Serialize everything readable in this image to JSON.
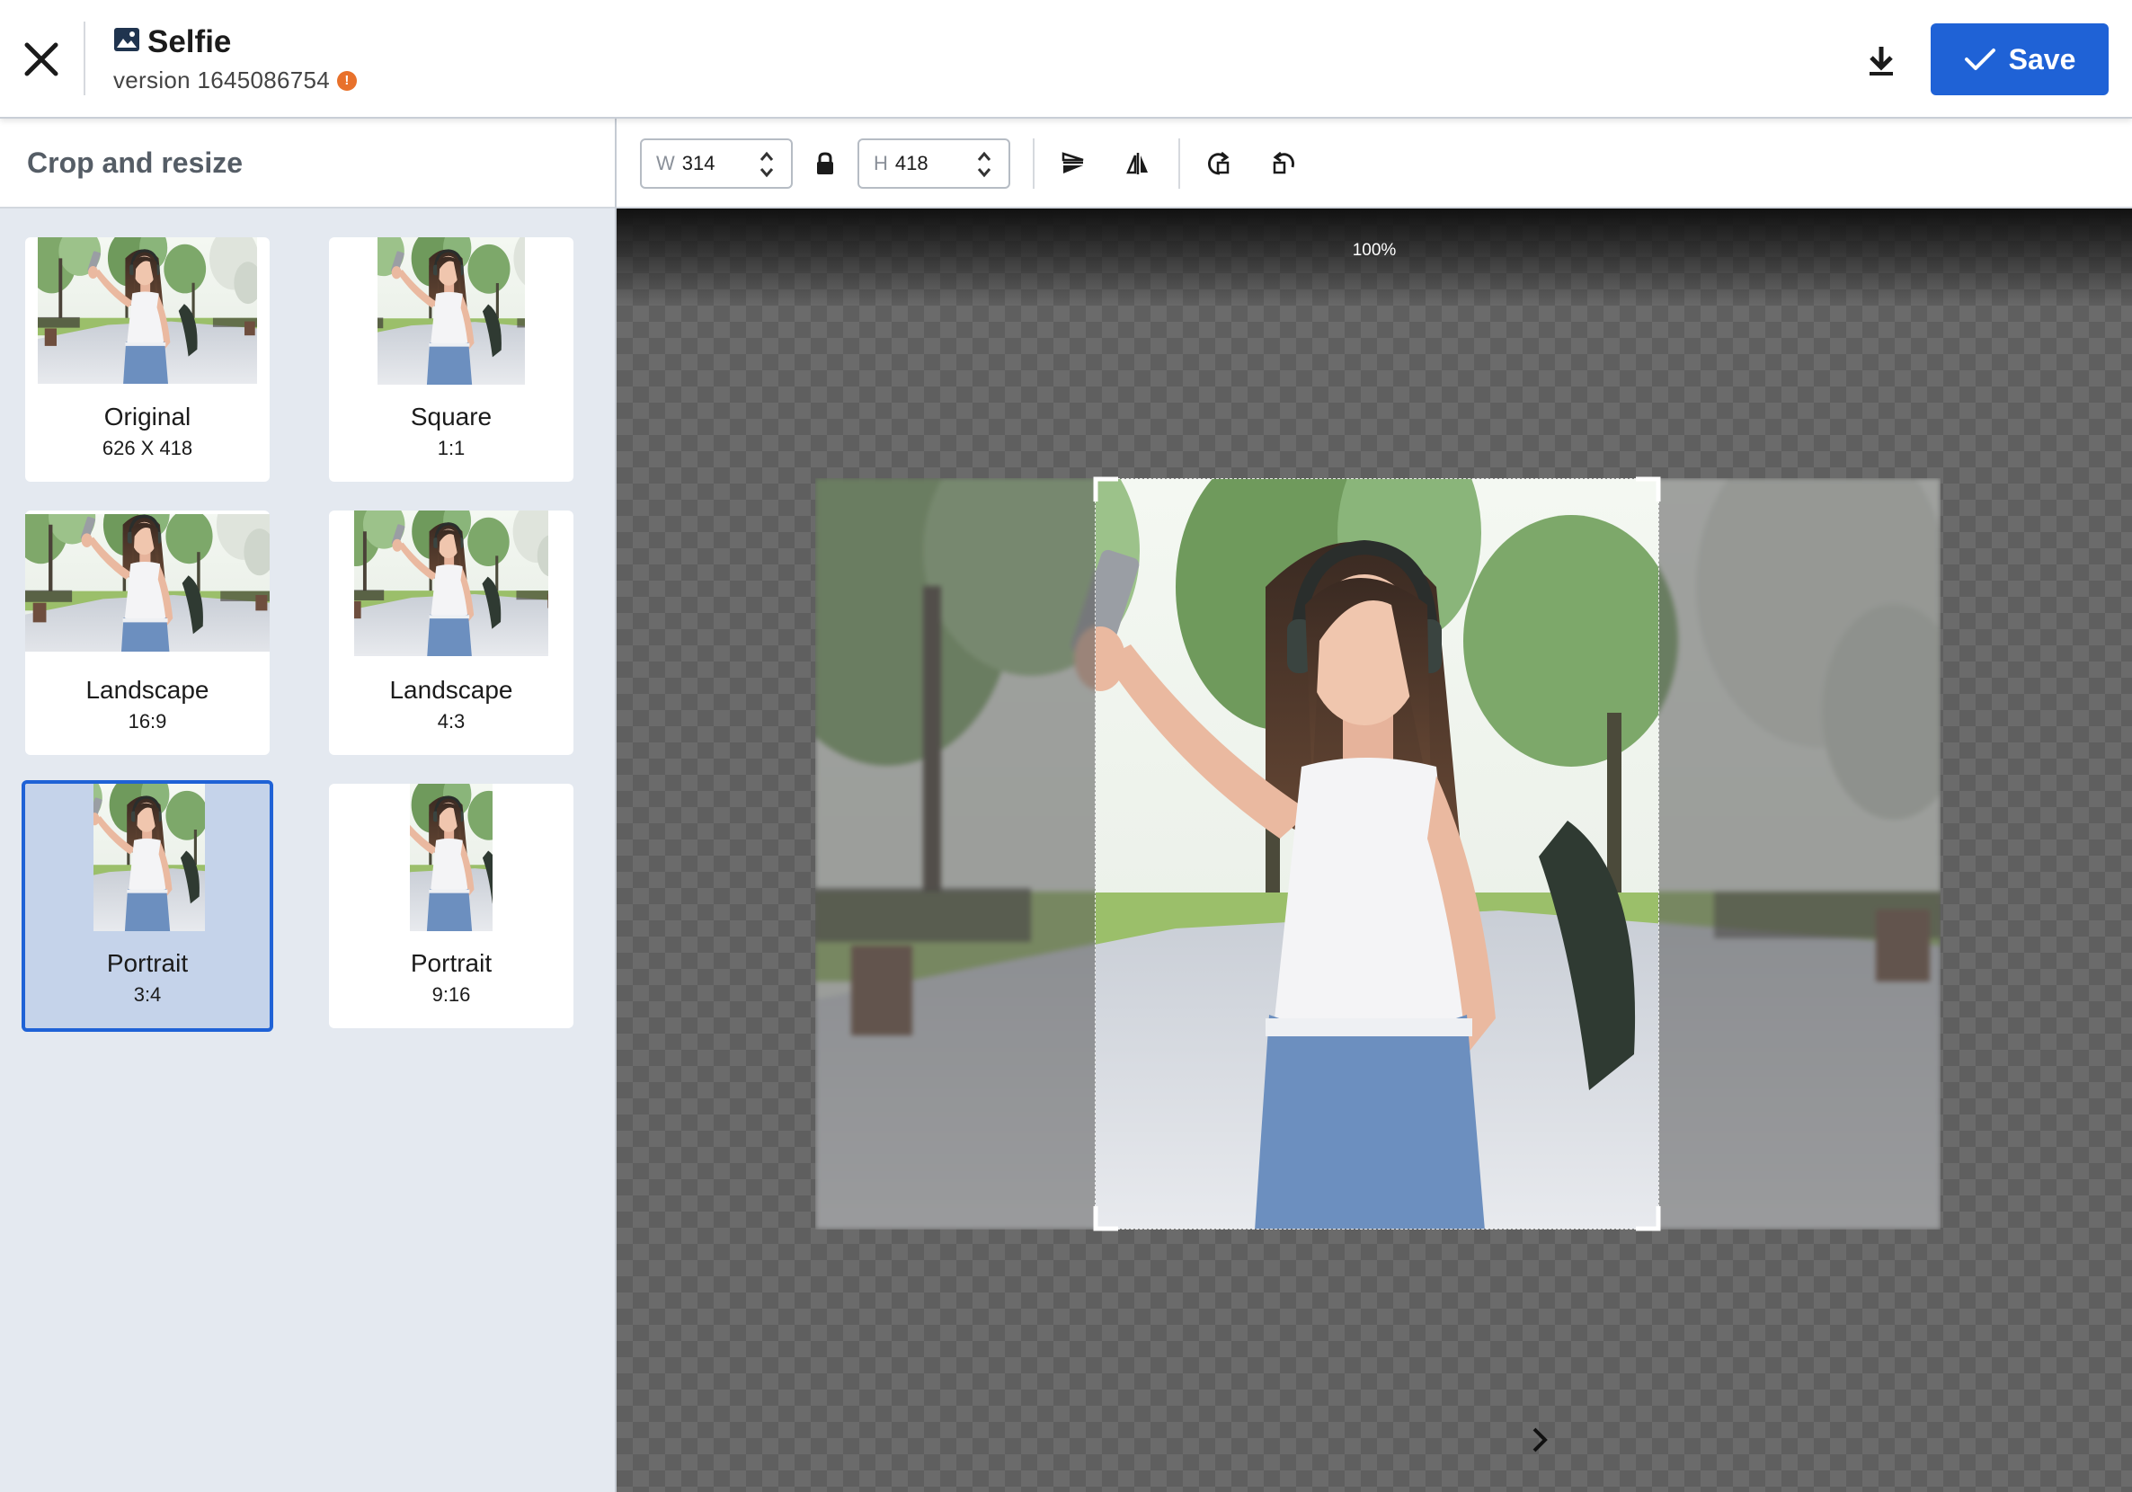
{
  "header": {
    "title": "Selfie",
    "version": "version 1645086754",
    "version_warning": "!",
    "save_label": "Save"
  },
  "sidebar": {
    "heading": "Crop and resize",
    "presets": [
      {
        "name": "Original",
        "ratio": "626 X 418",
        "selected": false
      },
      {
        "name": "Square",
        "ratio": "1:1",
        "selected": false
      },
      {
        "name": "Landscape",
        "ratio": "16:9",
        "selected": false
      },
      {
        "name": "Landscape",
        "ratio": "4:3",
        "selected": false
      },
      {
        "name": "Portrait",
        "ratio": "3:4",
        "selected": true
      },
      {
        "name": "Portrait",
        "ratio": "9:16",
        "selected": false
      }
    ]
  },
  "toolbar": {
    "width_prefix": "W",
    "width_value": "314",
    "height_prefix": "H",
    "height_value": "418",
    "lock_icon": "lock-icon",
    "tools": [
      "flip-vertical-icon",
      "flip-horizontal-icon",
      "rotate-right-icon",
      "rotate-left-icon"
    ]
  },
  "canvas": {
    "zoom": "100%"
  },
  "colors": {
    "accent": "#1f62d6",
    "selected_bg": "#c5d3ea",
    "warning": "#e8712b",
    "sidebar_bg": "#e4e9f0"
  }
}
